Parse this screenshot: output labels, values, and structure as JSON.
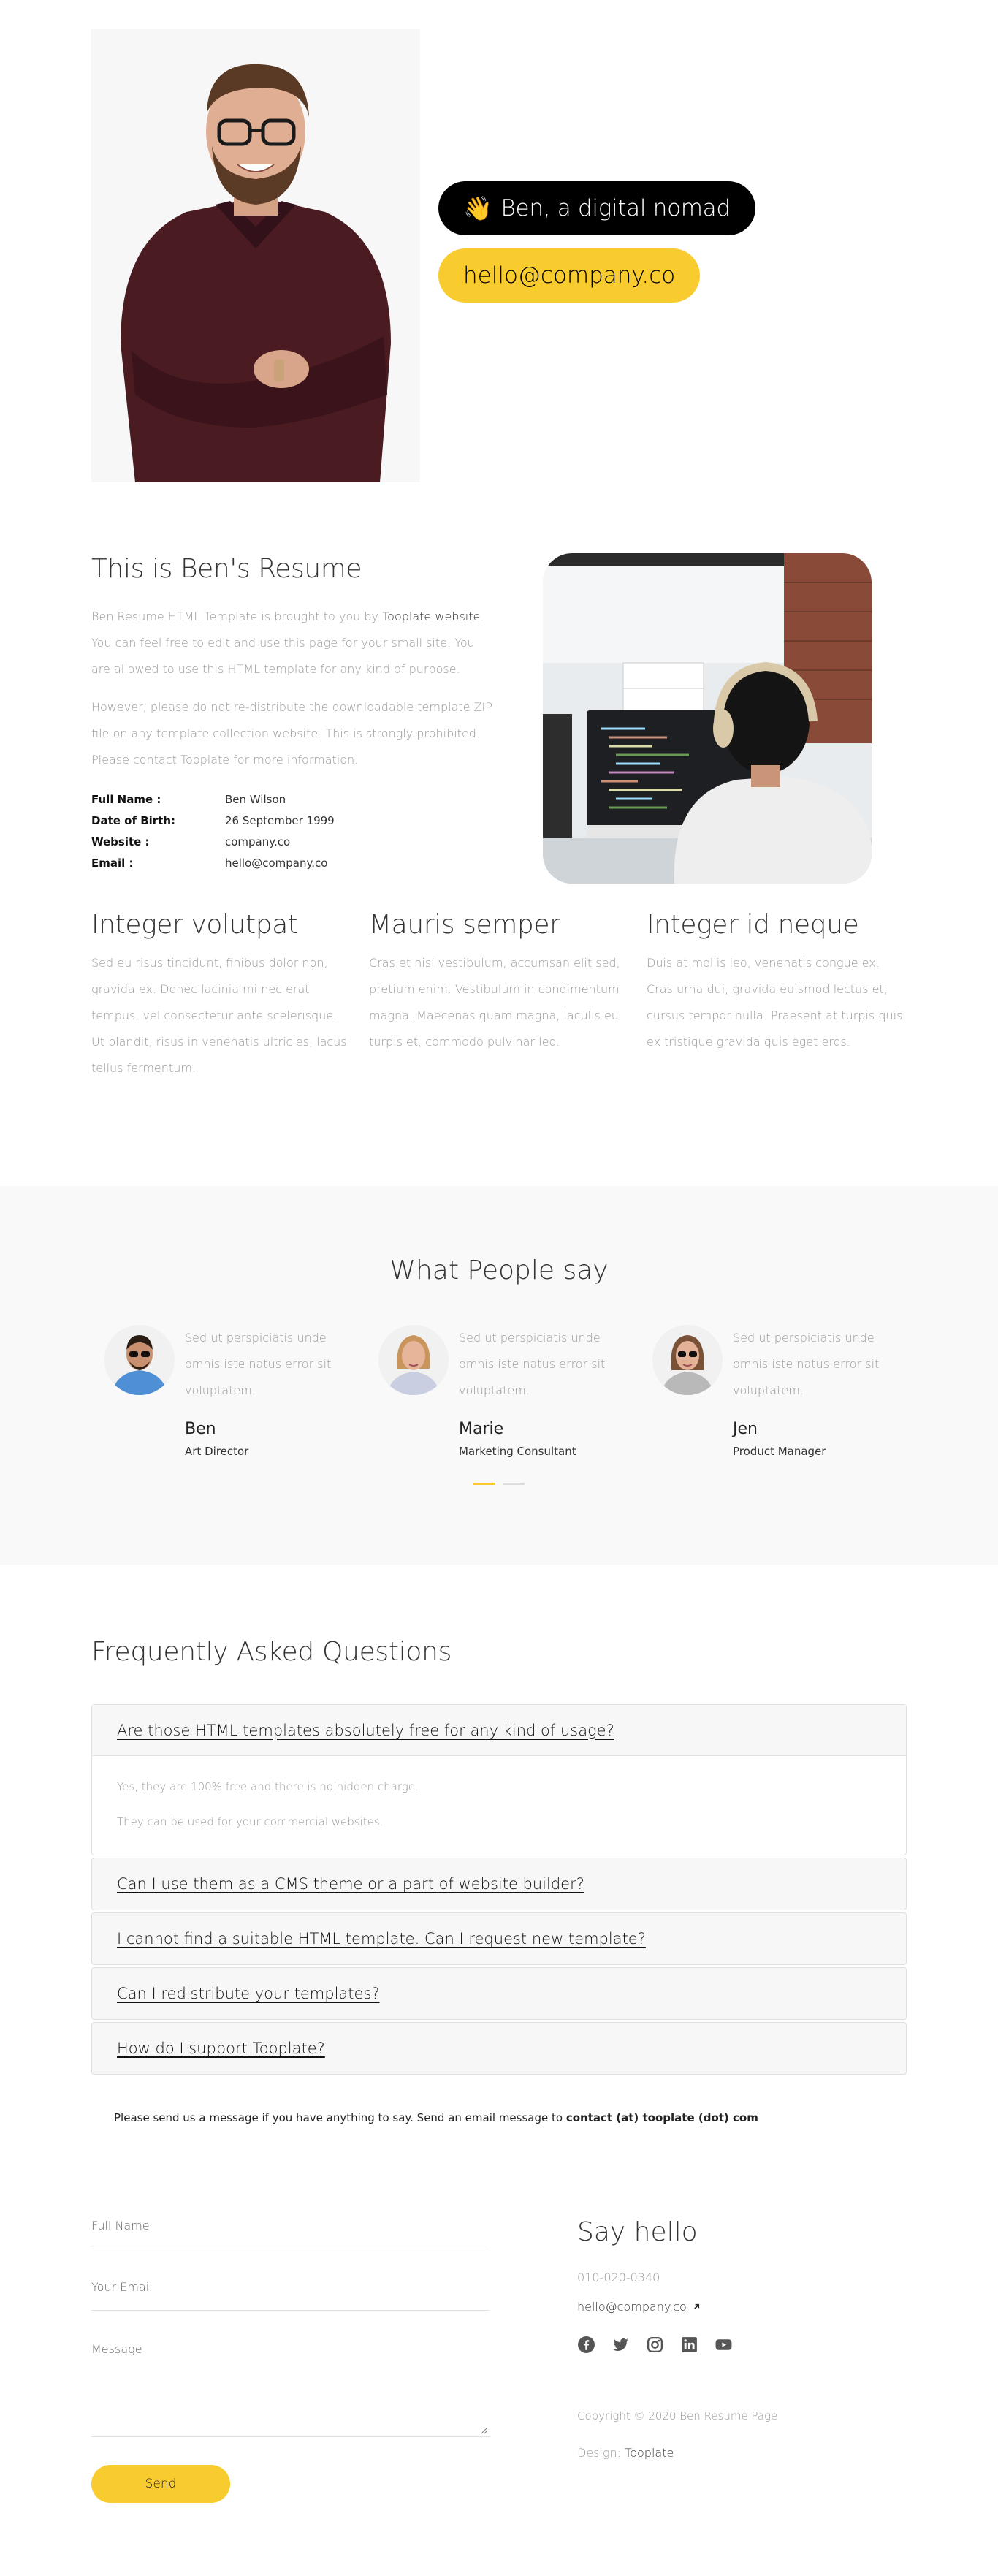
{
  "hero": {
    "wave_emoji": "👋",
    "intro": "Ben, a digital nomad",
    "email": "hello@company.co"
  },
  "about": {
    "title": "This is Ben's Resume",
    "p1_before": "Ben Resume HTML Template is brought to you by ",
    "p1_link": "Tooplate website",
    "p1_after": ". You can feel free to edit and use this page for your small site. You are allowed to use this HTML template for any kind of purpose.",
    "p2": "However, please do not re-distribute the downloadable template ZIP file on any template collection website. This is strongly prohibited. Please contact Tooplate for more information.",
    "info": [
      {
        "label": "Full Name :",
        "value": "Ben Wilson"
      },
      {
        "label": "Date of Birth:",
        "value": "26 September 1999"
      },
      {
        "label": "Website :",
        "value": "company.co"
      },
      {
        "label": "Email :",
        "value": "hello@company.co"
      }
    ]
  },
  "columns": [
    {
      "title": "Integer volutpat",
      "text": "Sed eu risus tincidunt, finibus dolor non, gravida ex. Donec lacinia mi nec erat tempus, vel consectetur ante scelerisque. Ut blandit, risus in venenatis ultricies, lacus tellus fermentum."
    },
    {
      "title": "Mauris semper",
      "text": "Cras et nisl vestibulum, accumsan elit sed, pretium enim. Vestibulum in condimentum magna. Maecenas quam magna, iaculis eu turpis et, commodo pulvinar leo."
    },
    {
      "title": "Integer id neque",
      "text": "Duis at mollis leo, venenatis congue ex. Cras urna dui, gravida euismod lectus et, cursus tempor nulla. Praesent at turpis quis ex tristique gravida quis eget eros."
    }
  ],
  "testimonials": {
    "title": "What People say",
    "items": [
      {
        "text": "Sed ut perspiciatis unde omnis iste natus error sit voluptatem.",
        "name": "Ben",
        "role": "Art Director"
      },
      {
        "text": "Sed ut perspiciatis unde omnis iste natus error sit voluptatem.",
        "name": "Marie",
        "role": "Marketing Consultant"
      },
      {
        "text": "Sed ut perspiciatis unde omnis iste natus error sit voluptatem.",
        "name": "Jen",
        "role": "Product Manager"
      }
    ]
  },
  "faq": {
    "title": "Frequently Asked Questions",
    "items": [
      {
        "q": "Are those HTML templates absolutely free for any kind of usage?",
        "open": true,
        "a": [
          "Yes, they are 100% free and there is no hidden charge.",
          "They can be used for your commercial websites."
        ]
      },
      {
        "q": "Can I use them as a CMS theme or a part of website builder?",
        "open": false
      },
      {
        "q": "I cannot find a suitable HTML template. Can I request new template?",
        "open": false
      },
      {
        "q": "Can I redistribute your templates?",
        "open": false
      },
      {
        "q": "How do I support Tooplate?",
        "open": false
      }
    ],
    "note_text": "Please send us a message if you have anything to say. Send an email message to ",
    "note_bold": "contact (at) tooplate (dot) com"
  },
  "contact": {
    "name_label": "Full Name",
    "email_label": "Your Email",
    "message_label": "Message",
    "send_label": "Send"
  },
  "footer": {
    "hello_title": "Say hello",
    "phone": "010-020-0340",
    "email": "hello@company.co",
    "copyright": "Copyright © 2020 Ben Resume Page",
    "design_label": "Design: ",
    "design_link": "Tooplate"
  },
  "colors": {
    "accent": "#f8cb2e",
    "dark": "#000000",
    "muted": "#999999",
    "section_bg": "#f9f9f9"
  },
  "icons": [
    "facebook-icon",
    "twitter-icon",
    "instagram-icon",
    "linkedin-icon",
    "youtube-icon",
    "external-arrow-icon"
  ]
}
